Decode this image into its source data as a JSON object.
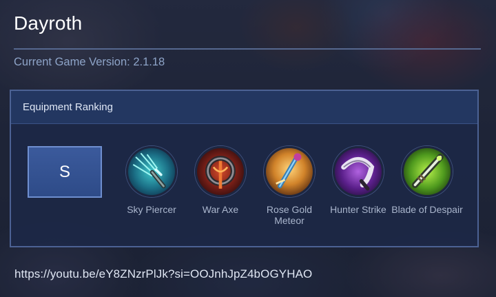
{
  "hero": {
    "name": "Dayroth"
  },
  "version": {
    "text": "Current Game Version: 2.1.18"
  },
  "equipment": {
    "header": "Equipment Ranking",
    "tier": "S",
    "items": [
      {
        "label": "Sky Piercer",
        "icon": "sky-piercer-icon"
      },
      {
        "label": "War Axe",
        "icon": "war-axe-icon"
      },
      {
        "label": "Rose Gold Meteor",
        "icon": "rose-gold-meteor-icon"
      },
      {
        "label": "Hunter Strike",
        "icon": "hunter-strike-icon"
      },
      {
        "label": "Blade of Despair",
        "icon": "blade-of-despair-icon"
      }
    ]
  },
  "footer": {
    "link": "https://youtu.be/eY8ZNzrPlJk?si=OOJnhJpZ4bOGYHAO"
  },
  "colors": {
    "panel_border": "#4c6294",
    "tier_bg": "#2e4b88",
    "divider": "#56688f"
  }
}
